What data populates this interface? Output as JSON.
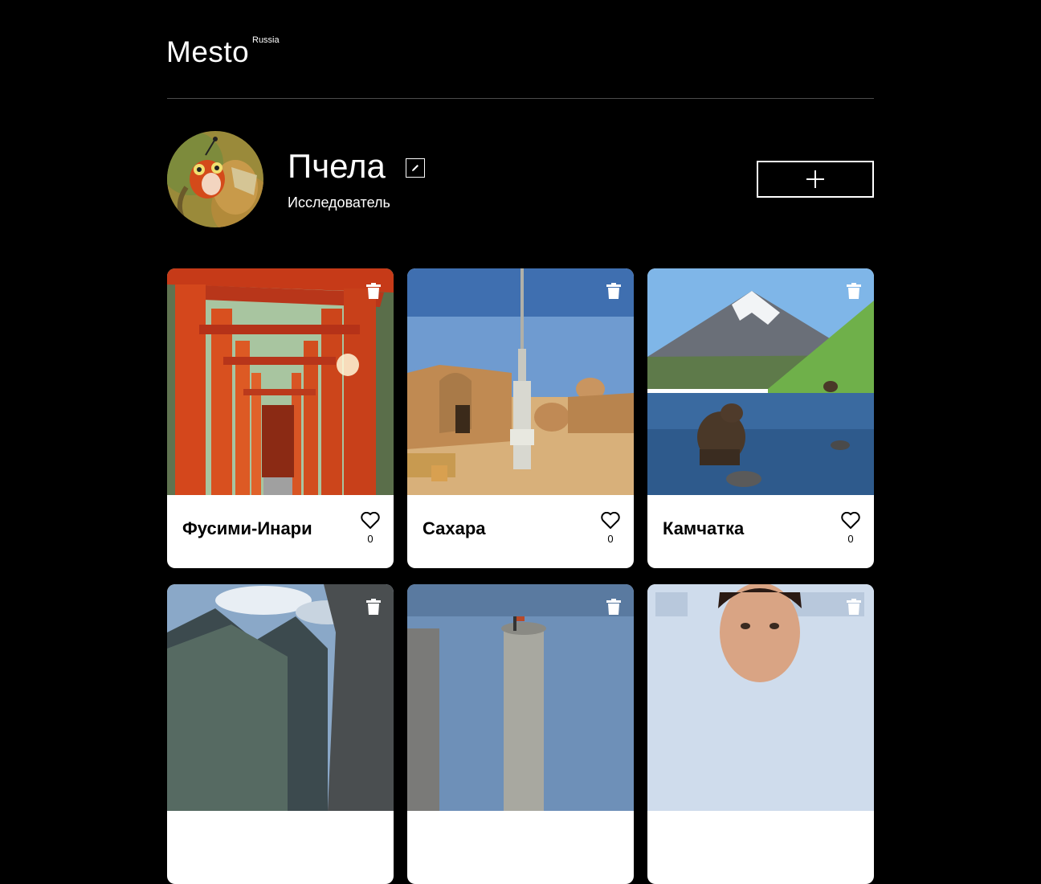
{
  "header": {
    "logo": "Mesto",
    "logo_sub": "Russia"
  },
  "profile": {
    "name": "Пчела",
    "about": "Исследователь",
    "avatar_icon": "bee-avatar",
    "edit_icon": "pencil-icon",
    "add_icon": "plus-icon"
  },
  "cards": [
    {
      "title": "Фусими-Инари",
      "likes": "0",
      "image": "torii-gates"
    },
    {
      "title": "Сахара",
      "likes": "0",
      "image": "desert-village"
    },
    {
      "title": "Камчатка",
      "likes": "0",
      "image": "volcano-bear"
    },
    {
      "title": "",
      "likes": "",
      "image": "mountains"
    },
    {
      "title": "",
      "likes": "",
      "image": "castle-tower"
    },
    {
      "title": "",
      "likes": "",
      "image": "man-portrait"
    }
  ],
  "colors": {
    "background": "#000000",
    "card": "#ffffff",
    "divider": "#545454"
  }
}
